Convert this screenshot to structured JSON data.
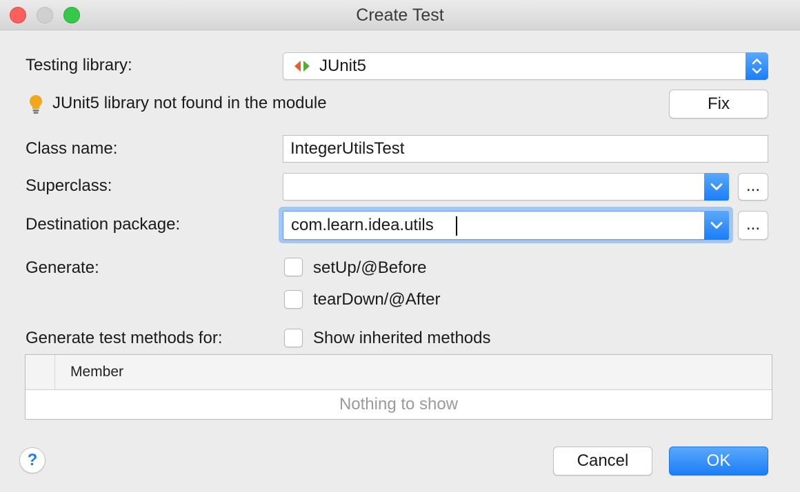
{
  "window": {
    "title": "Create Test"
  },
  "form": {
    "testing_library_label": "Testing library:",
    "testing_library_value": "JUnit5",
    "warning_text": "JUnit5 library not found in the module",
    "fix_label": "Fix",
    "class_name_label": "Class name:",
    "class_name_value": "IntegerUtilsTest",
    "superclass_label": "Superclass:",
    "superclass_value": "",
    "browse_label": "...",
    "destination_label": "Destination package:",
    "destination_value": "com.learn.idea.utils",
    "generate_label": "Generate:",
    "generate_options": [
      {
        "label": "setUp/@Before",
        "checked": false
      },
      {
        "label": "tearDown/@After",
        "checked": false
      }
    ],
    "methods_label": "Generate test methods for:",
    "show_inherited_label": "Show inherited methods",
    "show_inherited_checked": false
  },
  "members_table": {
    "columns": [
      "Member"
    ],
    "rows": [],
    "empty_text": "Nothing to show"
  },
  "buttons": {
    "help": "?",
    "cancel": "Cancel",
    "ok": "OK"
  },
  "colors": {
    "accent": "#1b7ef7",
    "warning_bulb": "#f0a71e",
    "junit_left": "#e3612a",
    "junit_right": "#59a839"
  },
  "icons": [
    "junit-icon",
    "lightbulb-icon",
    "chevron-down-icon",
    "up-down-arrows-icon",
    "help-icon"
  ]
}
